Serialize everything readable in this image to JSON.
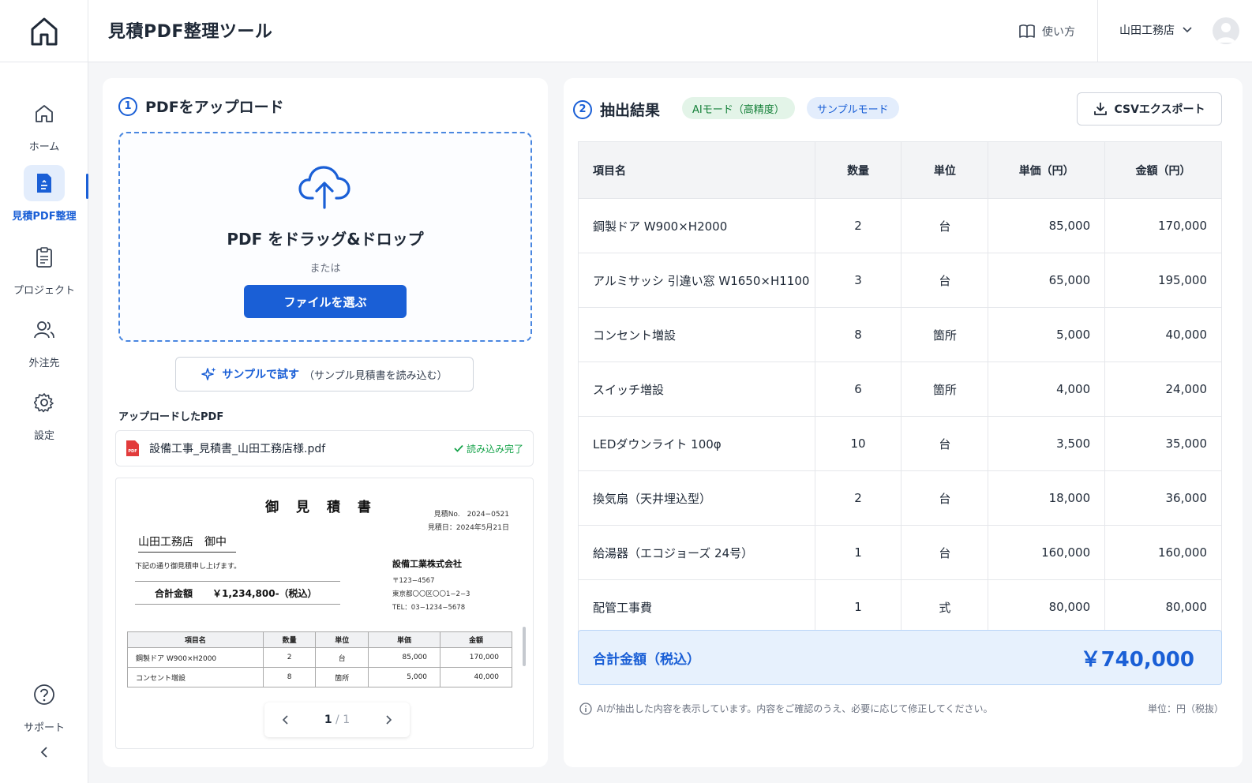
{
  "header": {
    "title": "見積PDF整理ツール",
    "howto_label": "使い方",
    "company": "山田工務店"
  },
  "sidebar": {
    "items": [
      {
        "label": "ホーム",
        "icon": "home-icon"
      },
      {
        "label": "見積PDF整理",
        "icon": "pdf-doc-icon",
        "active": true
      },
      {
        "label": "プロジェクト",
        "icon": "clipboard-icon"
      },
      {
        "label": "外注先",
        "icon": "users-icon"
      },
      {
        "label": "設定",
        "icon": "gear-icon"
      },
      {
        "label": "サポート",
        "icon": "help-icon"
      }
    ]
  },
  "upload": {
    "step": "1",
    "title": "PDFをアップロード",
    "drop_title": "PDF をドラッグ&ドロップ",
    "or_text": "または",
    "choose_label": "ファイルを選ぶ",
    "sample_label": "サンプルで試す",
    "sample_note": "（サンプル見積書を読み込む）",
    "uploaded_label": "アップロードしたPDF",
    "file_name": "設備工事_見積書_山田工務店様.pdf",
    "file_status": "読み込み完了"
  },
  "preview": {
    "doc_title": "御 見 積 書",
    "doc_no": "見積No.　2024−0521",
    "doc_date": "見積日：2024年5月21日",
    "client": "山田工務店　御中",
    "note": "下記の通り御見積申し上げます。",
    "total_label": "合計金額",
    "total_value": "￥1,234,800-（税込）",
    "supplier": "設備工業株式会社",
    "addr_zip": "〒123−4567",
    "addr_line": "東京都〇〇区〇〇1−2−3",
    "addr_tel": "TEL：03−1234−5678",
    "table_headers": [
      "項目名",
      "数量",
      "単位",
      "単価",
      "金額"
    ],
    "table_rows": [
      [
        "鋼製ドア W900×H2000",
        "2",
        "台",
        "85,000",
        "170,000"
      ],
      [
        "コンセント増設",
        "8",
        "箇所",
        "5,000",
        "40,000"
      ]
    ],
    "page_current": "1",
    "page_sep": "/",
    "page_total": "1"
  },
  "results": {
    "step": "2",
    "title": "抽出結果",
    "badge_ai": "AIモード（高精度）",
    "badge_sample": "サンプルモード",
    "csv_label": "CSVエクスポート",
    "headers": [
      "項目名",
      "数量",
      "単位",
      "単価（円）",
      "金額（円）"
    ],
    "rows": [
      [
        "鋼製ドア W900×H2000",
        "2",
        "台",
        "85,000",
        "170,000"
      ],
      [
        "アルミサッシ 引違い窓 W1650×H1100",
        "3",
        "台",
        "65,000",
        "195,000"
      ],
      [
        "コンセント増設",
        "8",
        "箇所",
        "5,000",
        "40,000"
      ],
      [
        "スイッチ増設",
        "6",
        "箇所",
        "4,000",
        "24,000"
      ],
      [
        "LEDダウンライト 100φ",
        "10",
        "台",
        "3,500",
        "35,000"
      ],
      [
        "換気扇（天井埋込型）",
        "2",
        "台",
        "18,000",
        "36,000"
      ],
      [
        "給湯器（エコジョーズ 24号）",
        "1",
        "台",
        "160,000",
        "160,000"
      ],
      [
        "配管工事費",
        "1",
        "式",
        "80,000",
        "80,000"
      ]
    ],
    "total_label": "合計金額（税込）",
    "total_value": "￥740,000",
    "footnote": "AIが抽出した内容を表示しています。内容をご確認のうえ、必要に応じて修正してください。",
    "unit_note": "単位：円（税抜）"
  },
  "colors": {
    "primary": "#1a5fd6",
    "success": "#16a34a",
    "ai_badge_bg": "#e3f4e8",
    "sample_badge_bg": "#e3edfc"
  }
}
